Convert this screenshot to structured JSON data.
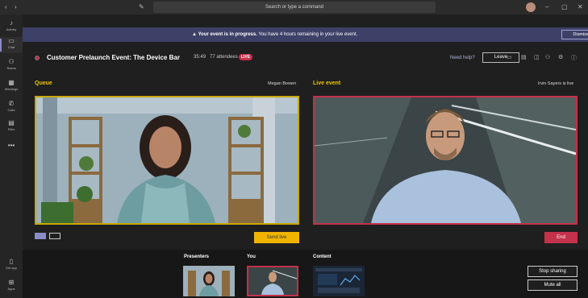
{
  "titlebar": {
    "search_placeholder": "Search or type a command"
  },
  "rail": {
    "items": [
      {
        "label": "Activity",
        "icon": "bell-icon"
      },
      {
        "label": "Chat",
        "icon": "chat-icon"
      },
      {
        "label": "Teams",
        "icon": "teams-icon"
      },
      {
        "label": "Meetings",
        "icon": "calendar-icon"
      },
      {
        "label": "Calls",
        "icon": "phone-icon"
      },
      {
        "label": "Files",
        "icon": "file-icon"
      },
      {
        "label": "Get app",
        "icon": "device-icon"
      },
      {
        "label": "Apps",
        "icon": "apps-icon"
      }
    ]
  },
  "banner": {
    "bold": "Your event is in progress.",
    "rest": " You have 4 hours remaining in your live event.",
    "dismiss_label": "Dismiss"
  },
  "event": {
    "title": "Customer Prelaunch Event: The Device Bar",
    "time": "35:49",
    "attendees": "77 attendees",
    "live_badge": "LIVE",
    "need_help": "Need help?",
    "leave_label": "Leave"
  },
  "queue": {
    "label": "Queue",
    "presenter": "Megan Bowen",
    "send_live_label": "Send live"
  },
  "live": {
    "label": "Live event",
    "status": "Irvin Sayers is live",
    "end_label": "End"
  },
  "strip": {
    "presenters_label": "Presenters",
    "you_label": "You",
    "content_label": "Content",
    "stop_sharing_label": "Stop sharing",
    "mute_all_label": "Mute all"
  },
  "colors": {
    "accent_yellow": "#f0c400",
    "live_red": "#c4314b",
    "banner": "#3d4067"
  }
}
